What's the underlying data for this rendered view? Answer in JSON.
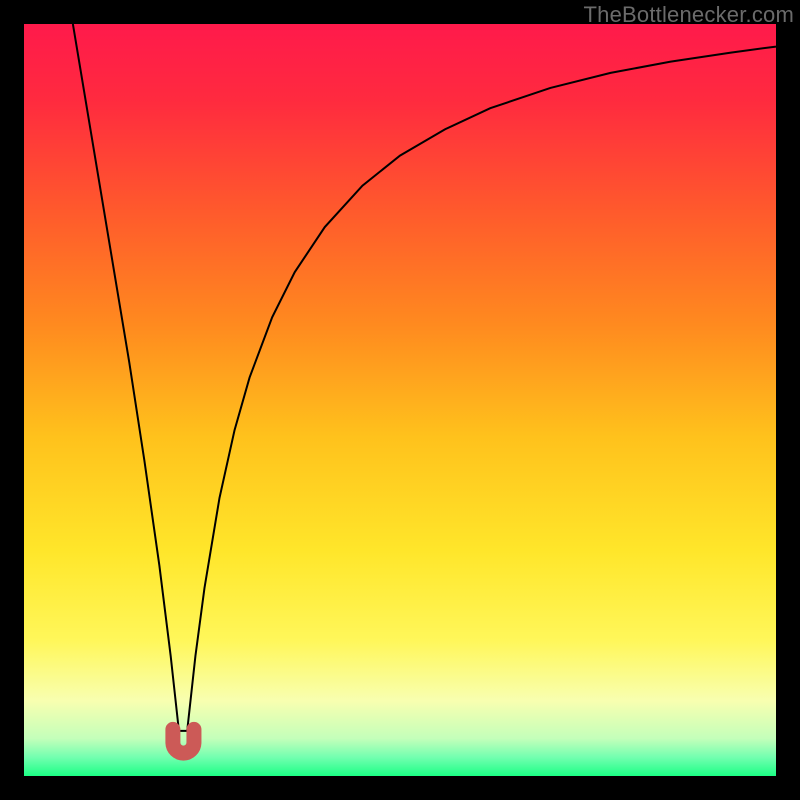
{
  "watermark": "TheBottlenecker.com",
  "chart_data": {
    "type": "line",
    "title": "",
    "xlabel": "",
    "ylabel": "",
    "xlim": [
      0,
      100
    ],
    "ylim": [
      0,
      100
    ],
    "background_gradient": {
      "stops": [
        {
          "offset": 0.0,
          "color": "#ff1a4b"
        },
        {
          "offset": 0.1,
          "color": "#ff2a3f"
        },
        {
          "offset": 0.25,
          "color": "#ff5a2c"
        },
        {
          "offset": 0.4,
          "color": "#ff8a1f"
        },
        {
          "offset": 0.55,
          "color": "#ffc21c"
        },
        {
          "offset": 0.7,
          "color": "#ffe62a"
        },
        {
          "offset": 0.82,
          "color": "#fff75a"
        },
        {
          "offset": 0.9,
          "color": "#f8ffb0"
        },
        {
          "offset": 0.95,
          "color": "#c4ffba"
        },
        {
          "offset": 0.975,
          "color": "#73ffb0"
        },
        {
          "offset": 1.0,
          "color": "#1cff85"
        }
      ]
    },
    "series": [
      {
        "name": "curve",
        "color": "#000000",
        "stroke_width": 2,
        "x": [
          6.5,
          8,
          10,
          12,
          14,
          16,
          18,
          19.5,
          20.6,
          21.7,
          22.8,
          24,
          26,
          28,
          30,
          33,
          36,
          40,
          45,
          50,
          56,
          62,
          70,
          78,
          86,
          94,
          100
        ],
        "y": [
          100,
          91,
          79,
          67,
          55,
          42,
          28,
          16,
          6,
          6,
          16,
          25,
          37,
          46,
          53,
          61,
          67,
          73,
          78.5,
          82.5,
          86,
          88.8,
          91.5,
          93.5,
          95,
          96.2,
          97
        ]
      }
    ],
    "markers": [
      {
        "name": "valley-marker",
        "shape": "u",
        "color": "#cc5a57",
        "stroke_width": 15,
        "x": 21.2,
        "y_bottom": 3.0,
        "half_width": 1.4,
        "height": 3.2
      }
    ]
  }
}
